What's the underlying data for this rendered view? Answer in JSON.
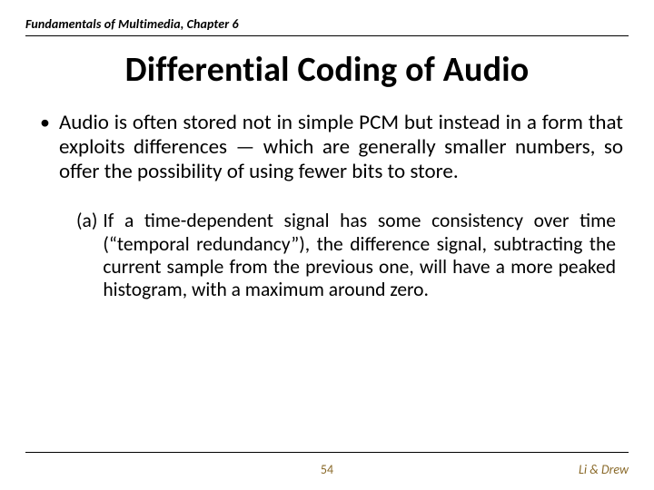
{
  "header": "Fundamentals of Multimedia, Chapter 6",
  "title": "Differential Coding of Audio",
  "bullet_marker": "•",
  "bullet_text": "Audio is often stored not in simple PCM but instead in a form that exploits differences — which are generally smaller numbers, so offer the possibility of using fewer bits to store.",
  "sub_label": "(a)",
  "sub_text": "If a time-dependent signal has some consistency over time (“temporal redundancy”), the difference signal, subtracting the current sample from the previous one, will have a more peaked histogram, with a maximum around zero.",
  "page_number": "54",
  "authors": "Li & Drew"
}
